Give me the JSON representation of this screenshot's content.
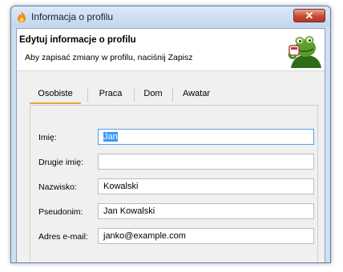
{
  "window": {
    "title": "Informacja o profilu",
    "close_glyph": "✕"
  },
  "header": {
    "title": "Edytuj informacje o profilu",
    "subtitle": "Aby zapisać zmiany w profilu, naciśnij Zapisz",
    "mascot_icon": "kermit-drinking-tea-icon"
  },
  "tabs": [
    {
      "label": "Osobiste",
      "active": true
    },
    {
      "label": "Praca",
      "active": false
    },
    {
      "label": "Dom",
      "active": false
    },
    {
      "label": "Awatar",
      "active": false
    }
  ],
  "form": {
    "fields": [
      {
        "label": "Imię:",
        "value": "Jan",
        "focused": true,
        "selected": true
      },
      {
        "label": "Drugie imię:",
        "value": ""
      },
      {
        "label": "Nazwisko:",
        "value": "Kowalski"
      },
      {
        "label": "Pseudonim:",
        "value": "Jan Kowalski"
      },
      {
        "label": "Adres e-mail:",
        "value": "janko@example.com"
      }
    ]
  },
  "colors": {
    "accent_tab": "#e8a24a",
    "focus_border": "#569de5",
    "selection": "#3399ff"
  }
}
